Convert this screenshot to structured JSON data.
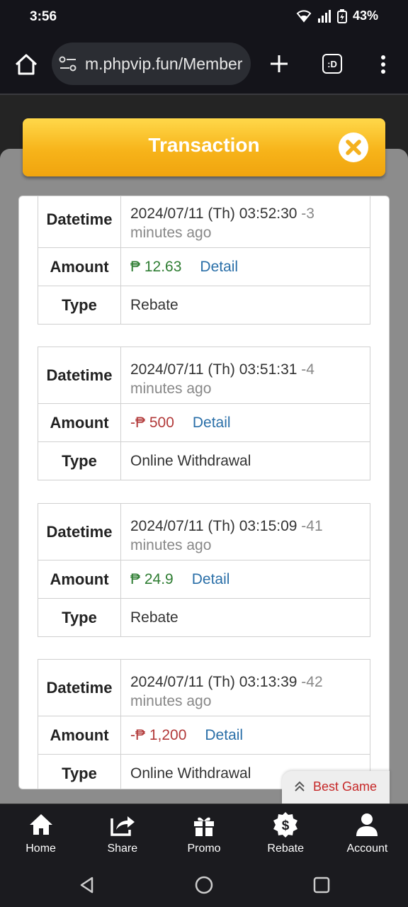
{
  "status_bar": {
    "time": "3:56",
    "battery": "43%"
  },
  "browser": {
    "url": "m.phpvip.fun/Member",
    "tabs_label": ":D"
  },
  "header": {
    "title": "Transaction"
  },
  "labels": {
    "datetime": "Datetime",
    "amount": "Amount",
    "type": "Type",
    "detail": "Detail"
  },
  "transactions": [
    {
      "datetime": "2024/07/11 (Th) 03:52:30",
      "ago_prefix": "-3",
      "ago_suffix": "minutes ago",
      "amount": "₱ 12.63",
      "amount_sign": "positive",
      "type": "Rebate"
    },
    {
      "datetime": "2024/07/11 (Th) 03:51:31",
      "ago_prefix": "-4",
      "ago_suffix": "minutes ago",
      "amount": "-₱ 500",
      "amount_sign": "negative",
      "type": "Online Withdrawal"
    },
    {
      "datetime": "2024/07/11 (Th) 03:15:09",
      "ago_prefix": "-41",
      "ago_suffix": "minutes ago",
      "amount": "₱ 24.9",
      "amount_sign": "positive",
      "type": "Rebate"
    },
    {
      "datetime": "2024/07/11 (Th) 03:13:39",
      "ago_prefix": "-42",
      "ago_suffix": "minutes ago",
      "amount": "-₱ 1,200",
      "amount_sign": "negative",
      "type": "Online Withdrawal"
    }
  ],
  "best_game": {
    "label": "Best Game"
  },
  "bottom_nav": [
    {
      "label": "Home",
      "icon": "home-icon"
    },
    {
      "label": "Share",
      "icon": "share-icon"
    },
    {
      "label": "Promo",
      "icon": "gift-icon"
    },
    {
      "label": "Rebate",
      "icon": "dollar-badge-icon"
    },
    {
      "label": "Account",
      "icon": "user-icon"
    }
  ],
  "colors": {
    "accent": "#f7b41a",
    "positive": "#2e7d32",
    "negative": "#b23a3a",
    "link": "#2a6fa8",
    "best_game": "#c62828"
  }
}
